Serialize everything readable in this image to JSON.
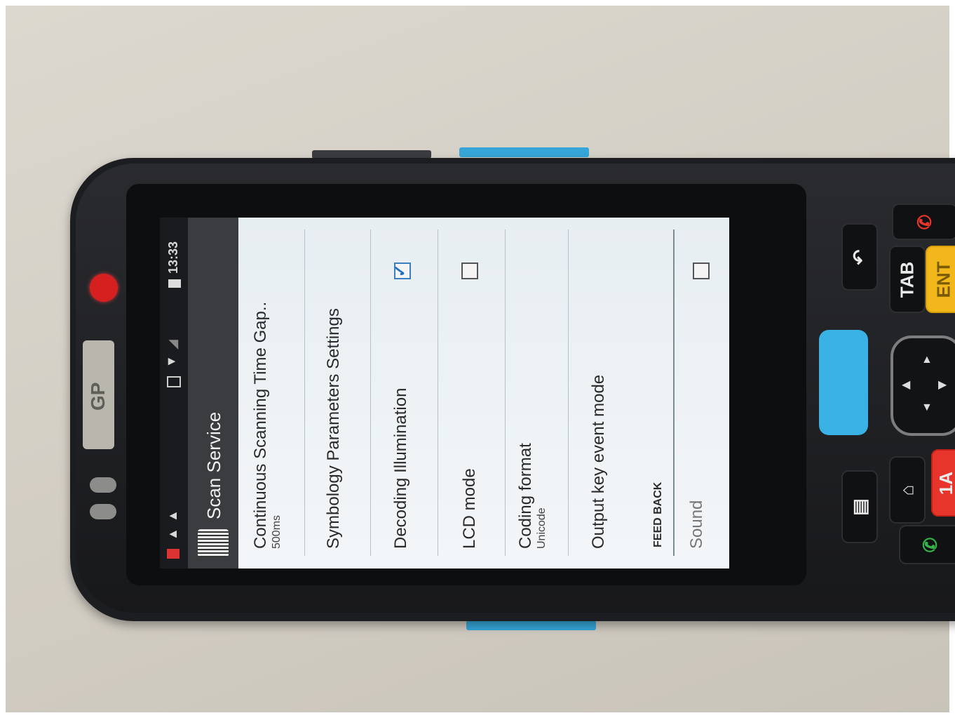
{
  "device": {
    "brand_logo": "GP",
    "colors": {
      "accent": "#36a6d8",
      "led": "#d6201f",
      "ent_key": "#f2b81b",
      "red_key": "#e8352c"
    }
  },
  "status_bar": {
    "time": "13:33",
    "icons": [
      "sd-card-icon",
      "warning-icon",
      "warning-icon",
      "sim-icon",
      "wifi-icon",
      "signal-icon",
      "battery-icon"
    ]
  },
  "title_bar": {
    "app_icon": "barcode-icon",
    "title": "Scan Service"
  },
  "settings": {
    "items": [
      {
        "title": "Continuous Scanning Time Gap..",
        "summary": "500ms"
      },
      {
        "title": "Symbology Parameters Settings",
        "summary": ""
      },
      {
        "title": "Decoding Illumination",
        "summary": "",
        "checked": true
      },
      {
        "title": "LCD mode",
        "summary": "",
        "checked": false
      },
      {
        "title": "Coding format",
        "summary": "Unicode"
      },
      {
        "title": "Output key event mode",
        "summary": ""
      }
    ],
    "section_header": "FEED BACK",
    "sound_item": {
      "title": "Sound",
      "checked": false
    }
  },
  "keypad": {
    "tab_label": "TAB",
    "ent_label": "ENT",
    "num_label": "1A"
  }
}
